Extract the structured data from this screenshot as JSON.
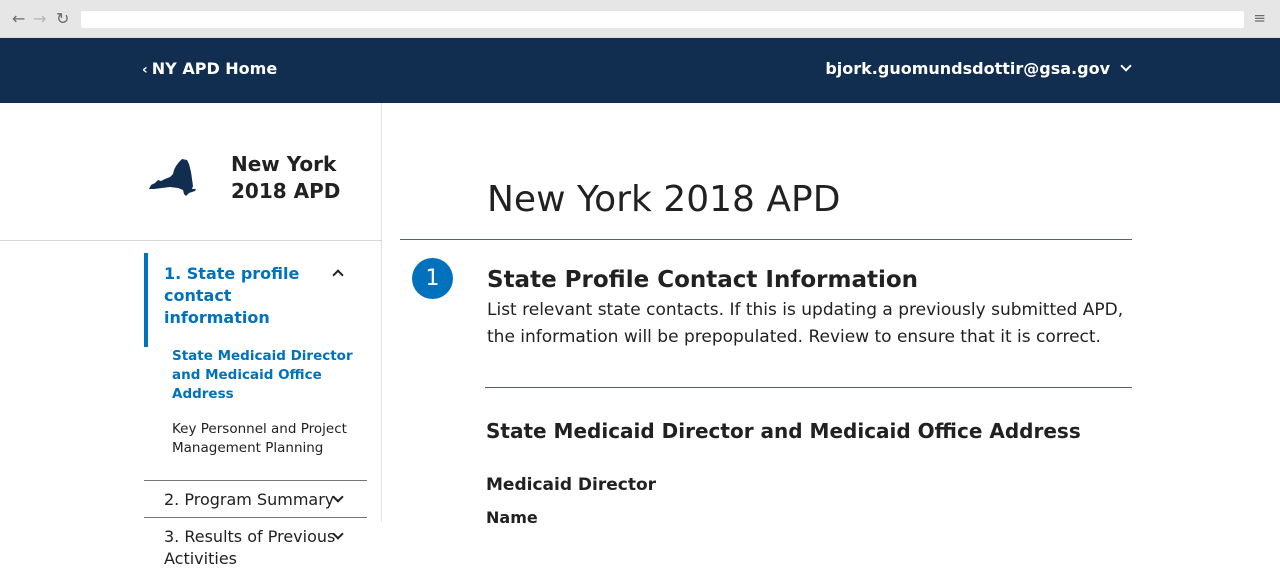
{
  "header": {
    "home_link": "NY APD Home",
    "user_email": "bjork.guomundsdottir@gsa.gov"
  },
  "sidebar": {
    "state_title_line1": "New York",
    "state_title_line2": "2018 APD",
    "nav": {
      "active_section": "1. State profile contact information",
      "sub_items": [
        "State Medicaid Director and Medicaid Office Address",
        "Key Personnel and Project Management Planning"
      ],
      "sections": [
        "2. Program Summary",
        "3. Results of Previous Activities"
      ]
    }
  },
  "main": {
    "title": "New York 2018 APD",
    "step_number": "1",
    "section_heading": "State Profile Contact Information",
    "section_description": "List relevant state contacts. If this is updating a previously submitted APD, the information will be prepopulated. Review to ensure that it is correct.",
    "sub_heading": "State Medicaid Director and Medicaid Office Address",
    "field_group_title": "Medicaid Director",
    "field_label": "Name"
  },
  "colors": {
    "header_bg": "#112e51",
    "accent": "#0071bc"
  }
}
